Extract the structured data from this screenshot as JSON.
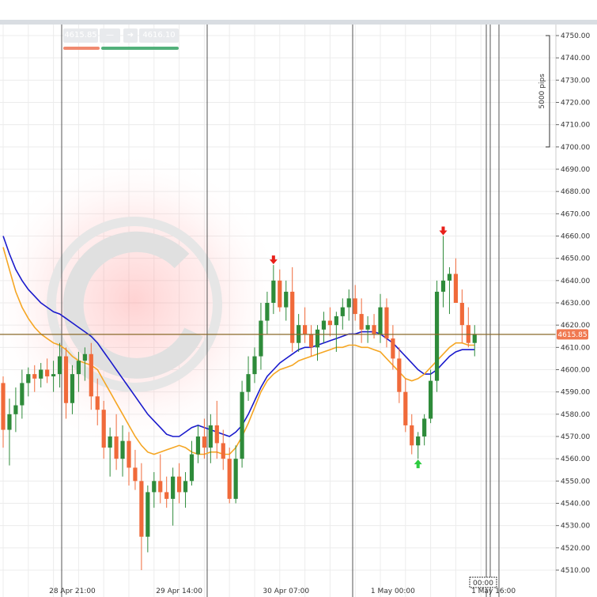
{
  "quote": {
    "bid": "4615.85",
    "spread_icon": "dash-icon",
    "ask_icon": "arrow-right-icon",
    "ask": "4616.10",
    "bid_color": "#f08a70",
    "ask_color": "#52b07a"
  },
  "scale_label": "5000 pips",
  "current_price_label": "4615.85",
  "time_cursor_label": "00:00",
  "colors": {
    "bull": "#2e8b3a",
    "bear": "#f06a3a",
    "ma_fast": "#f5a623",
    "ma_slow": "#1a1acc",
    "price_line": "#8a6a2a",
    "price_tag": "#f07850"
  },
  "chart_data": {
    "type": "candlestick",
    "y_axis": {
      "min": 4505,
      "max": 4755,
      "ticks": [
        "4750.00",
        "4740.00",
        "4730.00",
        "4720.00",
        "4710.00",
        "4700.00",
        "4690.00",
        "4680.00",
        "4670.00",
        "4660.00",
        "4650.00",
        "4640.00",
        "4630.00",
        "4620.00",
        "4610.00",
        "4600.00",
        "4590.00",
        "4580.00",
        "4570.00",
        "4560.00",
        "4550.00",
        "4540.00",
        "4530.00",
        "4520.00",
        "4510.00"
      ],
      "tick_values": [
        4750,
        4740,
        4730,
        4720,
        4710,
        4700,
        4690,
        4680,
        4670,
        4660,
        4650,
        4640,
        4630,
        4620,
        4610,
        4600,
        4590,
        4580,
        4570,
        4560,
        4550,
        4540,
        4530,
        4520,
        4510
      ]
    },
    "x_axis": {
      "labels": [
        "28 Apr 21:00",
        "29 Apr 14:00",
        "30 Apr 07:00",
        "1 May 00:00",
        "1 May 16:00"
      ],
      "label_bar_index": [
        11,
        28,
        45,
        62,
        78
      ]
    },
    "current_price": 4615.85,
    "scale_bracket": {
      "from": 4700,
      "to": 4750
    },
    "candles": [
      {
        "o": 4594,
        "h": 4597,
        "l": 4565,
        "c": 4573
      },
      {
        "o": 4573,
        "h": 4587,
        "l": 4557,
        "c": 4580
      },
      {
        "o": 4580,
        "h": 4592,
        "l": 4572,
        "c": 4584
      },
      {
        "o": 4584,
        "h": 4600,
        "l": 4578,
        "c": 4594
      },
      {
        "o": 4594,
        "h": 4601,
        "l": 4588,
        "c": 4598
      },
      {
        "o": 4598,
        "h": 4602,
        "l": 4590,
        "c": 4596
      },
      {
        "o": 4596,
        "h": 4603,
        "l": 4592,
        "c": 4600
      },
      {
        "o": 4600,
        "h": 4605,
        "l": 4594,
        "c": 4597
      },
      {
        "o": 4597,
        "h": 4604,
        "l": 4590,
        "c": 4598
      },
      {
        "o": 4598,
        "h": 4612,
        "l": 4592,
        "c": 4606
      },
      {
        "o": 4606,
        "h": 4610,
        "l": 4578,
        "c": 4585
      },
      {
        "o": 4585,
        "h": 4602,
        "l": 4580,
        "c": 4598
      },
      {
        "o": 4598,
        "h": 4608,
        "l": 4590,
        "c": 4604
      },
      {
        "o": 4604,
        "h": 4610,
        "l": 4595,
        "c": 4607
      },
      {
        "o": 4607,
        "h": 4612,
        "l": 4582,
        "c": 4588
      },
      {
        "o": 4588,
        "h": 4596,
        "l": 4575,
        "c": 4582
      },
      {
        "o": 4582,
        "h": 4586,
        "l": 4560,
        "c": 4565
      },
      {
        "o": 4565,
        "h": 4574,
        "l": 4552,
        "c": 4570
      },
      {
        "o": 4570,
        "h": 4580,
        "l": 4555,
        "c": 4560
      },
      {
        "o": 4560,
        "h": 4575,
        "l": 4552,
        "c": 4568
      },
      {
        "o": 4568,
        "h": 4572,
        "l": 4548,
        "c": 4556
      },
      {
        "o": 4556,
        "h": 4564,
        "l": 4546,
        "c": 4550
      },
      {
        "o": 4550,
        "h": 4558,
        "l": 4510,
        "c": 4525
      },
      {
        "o": 4525,
        "h": 4548,
        "l": 4518,
        "c": 4545
      },
      {
        "o": 4545,
        "h": 4554,
        "l": 4538,
        "c": 4550
      },
      {
        "o": 4550,
        "h": 4562,
        "l": 4540,
        "c": 4545
      },
      {
        "o": 4545,
        "h": 4552,
        "l": 4538,
        "c": 4542
      },
      {
        "o": 4542,
        "h": 4556,
        "l": 4530,
        "c": 4552
      },
      {
        "o": 4552,
        "h": 4558,
        "l": 4540,
        "c": 4545
      },
      {
        "o": 4545,
        "h": 4554,
        "l": 4538,
        "c": 4550
      },
      {
        "o": 4550,
        "h": 4568,
        "l": 4548,
        "c": 4562
      },
      {
        "o": 4562,
        "h": 4575,
        "l": 4558,
        "c": 4570
      },
      {
        "o": 4570,
        "h": 4578,
        "l": 4560,
        "c": 4565
      },
      {
        "o": 4565,
        "h": 4580,
        "l": 4558,
        "c": 4575
      },
      {
        "o": 4575,
        "h": 4586,
        "l": 4560,
        "c": 4567
      },
      {
        "o": 4567,
        "h": 4573,
        "l": 4555,
        "c": 4560
      },
      {
        "o": 4560,
        "h": 4565,
        "l": 4540,
        "c": 4542
      },
      {
        "o": 4542,
        "h": 4566,
        "l": 4540,
        "c": 4560
      },
      {
        "o": 4560,
        "h": 4595,
        "l": 4556,
        "c": 4590
      },
      {
        "o": 4590,
        "h": 4606,
        "l": 4586,
        "c": 4598
      },
      {
        "o": 4598,
        "h": 4610,
        "l": 4594,
        "c": 4606
      },
      {
        "o": 4606,
        "h": 4630,
        "l": 4600,
        "c": 4622
      },
      {
        "o": 4622,
        "h": 4635,
        "l": 4616,
        "c": 4630
      },
      {
        "o": 4630,
        "h": 4647,
        "l": 4625,
        "c": 4640
      },
      {
        "o": 4640,
        "h": 4645,
        "l": 4626,
        "c": 4628
      },
      {
        "o": 4628,
        "h": 4640,
        "l": 4622,
        "c": 4635
      },
      {
        "o": 4635,
        "h": 4646,
        "l": 4608,
        "c": 4612
      },
      {
        "o": 4612,
        "h": 4625,
        "l": 4608,
        "c": 4620
      },
      {
        "o": 4620,
        "h": 4628,
        "l": 4612,
        "c": 4616
      },
      {
        "o": 4616,
        "h": 4620,
        "l": 4606,
        "c": 4610
      },
      {
        "o": 4610,
        "h": 4620,
        "l": 4604,
        "c": 4618
      },
      {
        "o": 4618,
        "h": 4626,
        "l": 4612,
        "c": 4622
      },
      {
        "o": 4622,
        "h": 4628,
        "l": 4615,
        "c": 4620
      },
      {
        "o": 4620,
        "h": 4626,
        "l": 4608,
        "c": 4624
      },
      {
        "o": 4624,
        "h": 4632,
        "l": 4618,
        "c": 4628
      },
      {
        "o": 4628,
        "h": 4636,
        "l": 4622,
        "c": 4632
      },
      {
        "o": 4632,
        "h": 4638,
        "l": 4622,
        "c": 4625
      },
      {
        "o": 4625,
        "h": 4632,
        "l": 4612,
        "c": 4618
      },
      {
        "o": 4618,
        "h": 4624,
        "l": 4612,
        "c": 4620
      },
      {
        "o": 4620,
        "h": 4625,
        "l": 4614,
        "c": 4616
      },
      {
        "o": 4616,
        "h": 4634,
        "l": 4612,
        "c": 4628
      },
      {
        "o": 4628,
        "h": 4632,
        "l": 4610,
        "c": 4614
      },
      {
        "o": 4614,
        "h": 4620,
        "l": 4600,
        "c": 4605
      },
      {
        "o": 4605,
        "h": 4610,
        "l": 4585,
        "c": 4590
      },
      {
        "o": 4590,
        "h": 4596,
        "l": 4572,
        "c": 4575
      },
      {
        "o": 4575,
        "h": 4580,
        "l": 4562,
        "c": 4566
      },
      {
        "o": 4566,
        "h": 4572,
        "l": 4560,
        "c": 4570
      },
      {
        "o": 4570,
        "h": 4580,
        "l": 4566,
        "c": 4578
      },
      {
        "o": 4578,
        "h": 4600,
        "l": 4576,
        "c": 4595
      },
      {
        "o": 4595,
        "h": 4640,
        "l": 4590,
        "c": 4635
      },
      {
        "o": 4635,
        "h": 4660,
        "l": 4628,
        "c": 4640
      },
      {
        "o": 4640,
        "h": 4646,
        "l": 4625,
        "c": 4643
      },
      {
        "o": 4643,
        "h": 4650,
        "l": 4632,
        "c": 4630
      },
      {
        "o": 4630,
        "h": 4636,
        "l": 4612,
        "c": 4620
      },
      {
        "o": 4620,
        "h": 4628,
        "l": 4610,
        "c": 4612
      },
      {
        "o": 4612,
        "h": 4620,
        "l": 4606,
        "c": 4616
      }
    ],
    "series": [
      {
        "values": [
          4660,
          4652,
          4645,
          4640,
          4636,
          4633,
          4630,
          4628,
          4626,
          4625,
          4623,
          4621,
          4619,
          4617,
          4615,
          4612,
          4608,
          4604,
          4600,
          4596,
          4592,
          4588,
          4584,
          4580,
          4577,
          4574,
          4571,
          4570,
          4570,
          4572,
          4574,
          4575,
          4574,
          4573,
          4572,
          4571,
          4570,
          4572,
          4575,
          4580,
          4586,
          4592,
          4597,
          4600,
          4603,
          4605,
          4607,
          4609,
          4610,
          4610,
          4611,
          4612,
          4613,
          4614,
          4615,
          4616,
          4616,
          4617,
          4617,
          4617,
          4616,
          4614,
          4612,
          4609,
          4606,
          4603,
          4600,
          4598,
          4598,
          4600,
          4603,
          4606,
          4608,
          4609,
          4609,
          4609
        ]
      },
      {
        "values": [
          4655,
          4645,
          4635,
          4628,
          4623,
          4619,
          4616,
          4614,
          4612,
          4611,
          4609,
          4606,
          4604,
          4603,
          4602,
          4600,
          4595,
          4590,
          4585,
          4580,
          4575,
          4570,
          4566,
          4563,
          4562,
          4563,
          4564,
          4565,
          4566,
          4565,
          4563,
          4562,
          4562,
          4563,
          4563,
          4562,
          4562,
          4565,
          4570,
          4576,
          4583,
          4590,
          4595,
          4598,
          4600,
          4601,
          4602,
          4604,
          4605,
          4606,
          4607,
          4608,
          4609,
          4610,
          4610,
          4611,
          4611,
          4610,
          4610,
          4609,
          4608,
          4605,
          4602,
          4599,
          4596,
          4595,
          4596,
          4598,
          4601,
          4604,
          4607,
          4610,
          4612,
          4612,
          4611,
          4611
        ]
      }
    ],
    "markers": [
      {
        "type": "down",
        "bar": 43
      },
      {
        "type": "down",
        "bar": 70
      },
      {
        "type": "up",
        "bar": 66
      }
    ]
  }
}
